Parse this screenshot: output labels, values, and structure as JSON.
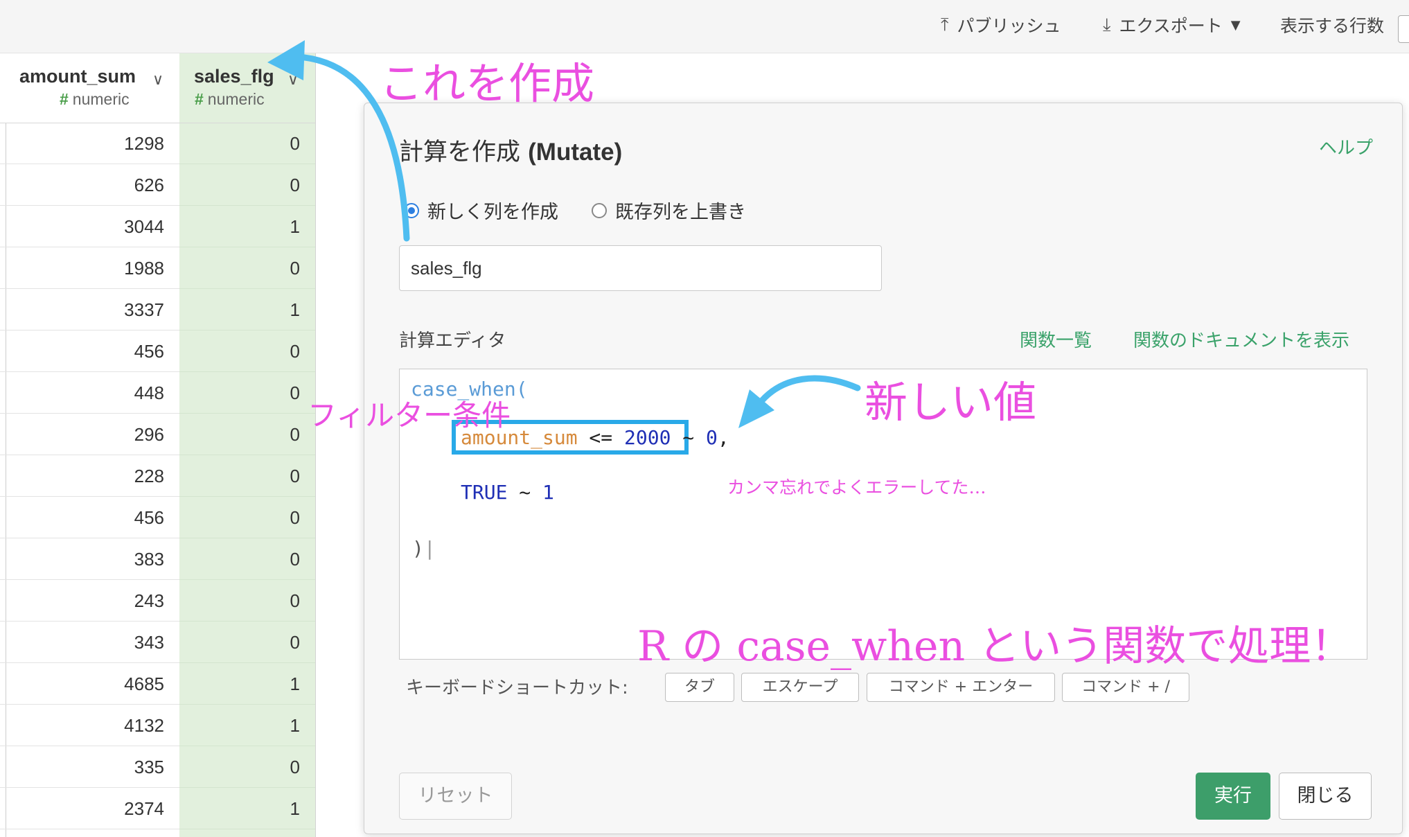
{
  "toolbar": {
    "publish_label": "パブリッシュ",
    "export_label": "エクスポート",
    "rows_label": "表示する行数"
  },
  "grid": {
    "columns": [
      {
        "name": "amount_sum",
        "type": "numeric"
      },
      {
        "name": "sales_flg",
        "type": "numeric"
      }
    ],
    "type_hash": "#",
    "rows": [
      [
        "1298",
        "0"
      ],
      [
        "626",
        "0"
      ],
      [
        "3044",
        "1"
      ],
      [
        "1988",
        "0"
      ],
      [
        "3337",
        "1"
      ],
      [
        "456",
        "0"
      ],
      [
        "448",
        "0"
      ],
      [
        "296",
        "0"
      ],
      [
        "228",
        "0"
      ],
      [
        "456",
        "0"
      ],
      [
        "383",
        "0"
      ],
      [
        "243",
        "0"
      ],
      [
        "343",
        "0"
      ],
      [
        "4685",
        "1"
      ],
      [
        "4132",
        "1"
      ],
      [
        "335",
        "0"
      ],
      [
        "2374",
        "1"
      ]
    ]
  },
  "modal": {
    "title_jp": "計算を作成",
    "title_en": "(Mutate)",
    "help_label": "ヘルプ",
    "radio_new": "新しく列を作成",
    "radio_overwrite": "既存列を上書き",
    "column_name_value": "sales_flg",
    "editor_label": "計算エディタ",
    "func_list_link": "関数一覧",
    "func_doc_link": "関数のドキュメントを表示",
    "code": {
      "line1_fn": "case_when(",
      "line2_var": "amount_sum",
      "line2_op": " <= ",
      "line2_num": "2000",
      "line2_tilde": " ~ ",
      "line2_val": "0",
      "line2_comma": ",",
      "line3_kw": "TRUE",
      "line3_tilde": " ~ ",
      "line3_val": "1",
      "line4": ")"
    },
    "shortcuts_label": "キーボードショートカット:",
    "shortcuts": [
      "タブ",
      "エスケープ",
      "コマンド + エンター",
      "コマンド + /"
    ],
    "reset_label": "リセット",
    "run_label": "実行",
    "close_label": "閉じる"
  },
  "annotations": {
    "create_this": "これを作成",
    "new_value": "新しい値",
    "filter_condition": "フィルター条件",
    "comma_note": "カンマ忘れでよくエラーしてた…",
    "r_function_note": "R の case_when という関数で処理！"
  },
  "colors": {
    "accent_green": "#3d9e6a",
    "column_highlight": "#e2f0dd",
    "annotation_pink": "#ea4fe0",
    "annotation_arrow": "#4fbdf0",
    "highlight_box": "#29a9e8"
  }
}
